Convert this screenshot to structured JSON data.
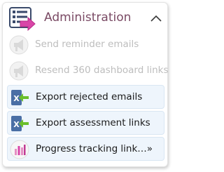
{
  "header": {
    "title": "Administration",
    "icon": "list-arrow-icon",
    "expanded": true
  },
  "colors": {
    "title": "#7a4a64",
    "arrow_pink": "#d946a8",
    "arrow_green": "#6abf2a",
    "excel_blue": "#4a6fa5",
    "active_row_bg": "#eef5fc",
    "disabled_text": "#bdbdbd"
  },
  "menu": {
    "items": [
      {
        "label": "Send reminder emails",
        "icon": "megaphone-icon",
        "enabled": false
      },
      {
        "label": "Resend 360 dashboard links",
        "icon": "megaphone-icon",
        "enabled": false
      },
      {
        "label": "Export rejected emails",
        "icon": "excel-export-icon",
        "enabled": true
      },
      {
        "label": "Export assessment links",
        "icon": "excel-export-icon",
        "enabled": true
      },
      {
        "label": "Progress tracking link…»",
        "icon": "bar-chart-icon",
        "enabled": true
      }
    ]
  }
}
